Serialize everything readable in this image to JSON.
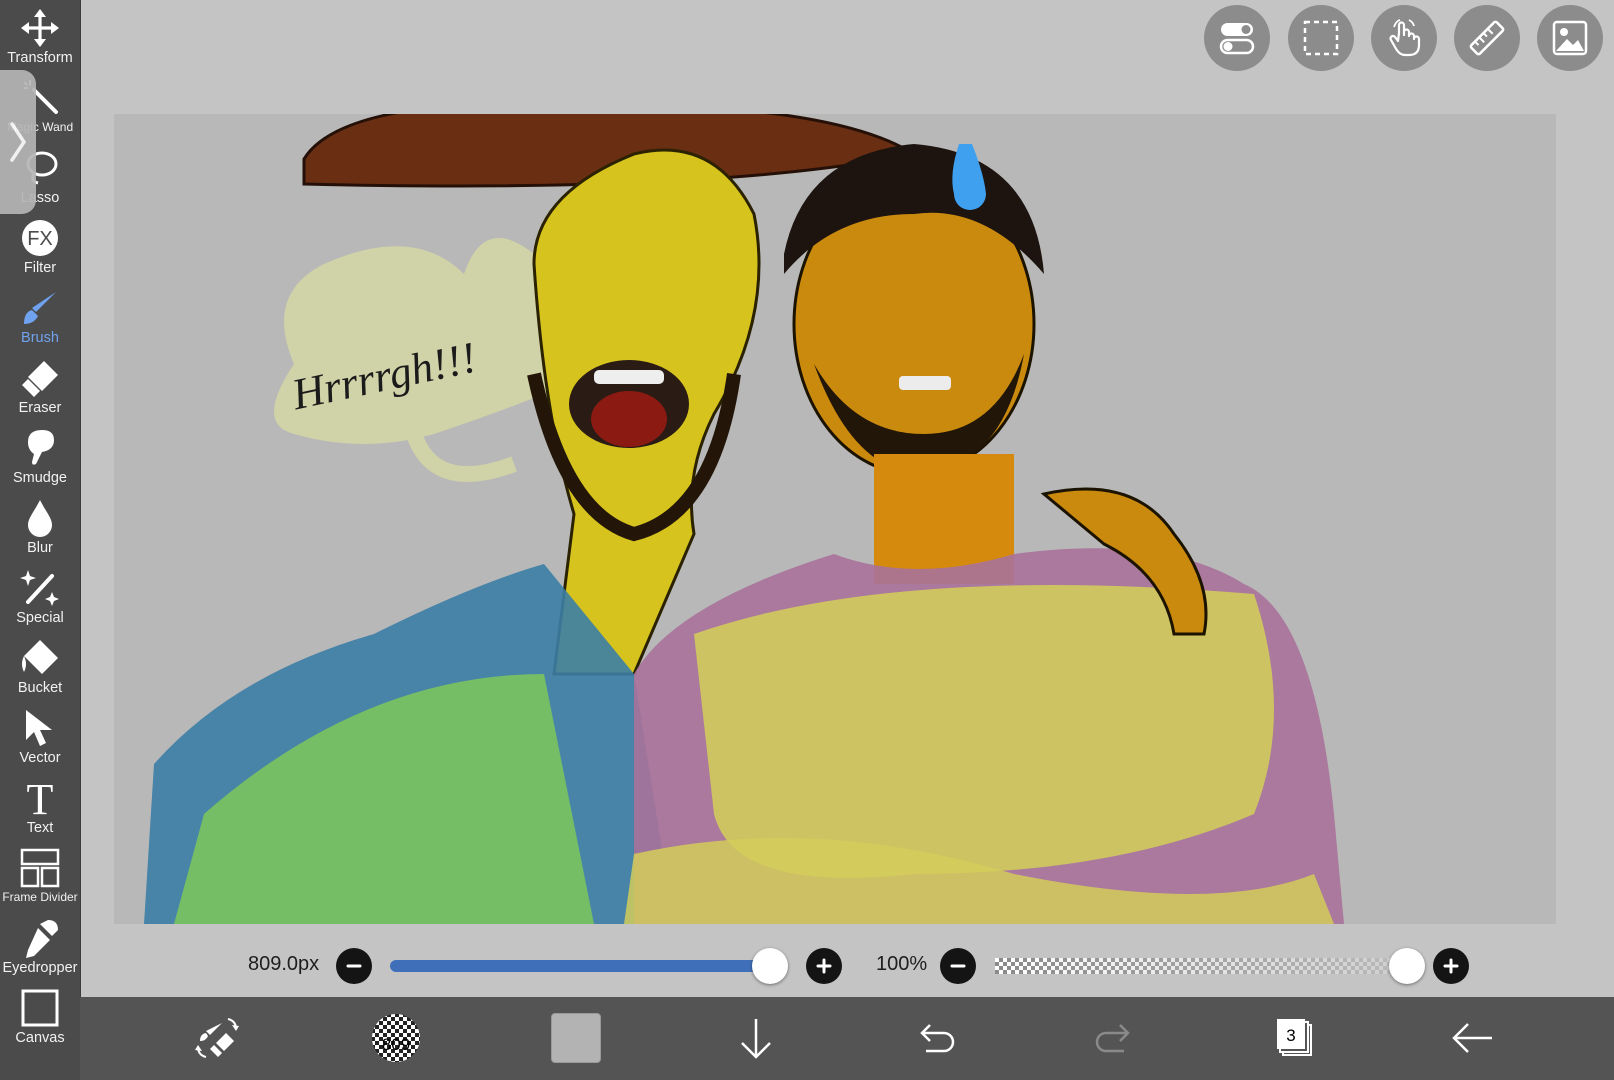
{
  "toolbar": {
    "tools": [
      {
        "id": "transform",
        "label": "Transform"
      },
      {
        "id": "magic-wand",
        "label": "Magic Wand"
      },
      {
        "id": "lasso",
        "label": "Lasso"
      },
      {
        "id": "filter",
        "label": "Filter",
        "glyph": "FX"
      },
      {
        "id": "brush",
        "label": "Brush"
      },
      {
        "id": "eraser",
        "label": "Eraser"
      },
      {
        "id": "smudge",
        "label": "Smudge"
      },
      {
        "id": "blur",
        "label": "Blur"
      },
      {
        "id": "special",
        "label": "Special"
      },
      {
        "id": "bucket",
        "label": "Bucket"
      },
      {
        "id": "vector",
        "label": "Vector"
      },
      {
        "id": "text",
        "label": "Text",
        "glyph": "T"
      },
      {
        "id": "frame-divider",
        "label": "Frame Divider"
      },
      {
        "id": "eyedropper",
        "label": "Eyedropper"
      },
      {
        "id": "canvas",
        "label": "Canvas"
      }
    ],
    "active_tool": "brush",
    "active_color": "#6fa3ef"
  },
  "top_buttons": [
    "toggle-icon",
    "selection-icon",
    "gesture-hand-icon",
    "ruler-icon",
    "image-icon"
  ],
  "canvas": {
    "speech_bubble_text": "Hrrrrgh!!!"
  },
  "brush_size": {
    "value_label": "809.0px",
    "fraction": 0.97
  },
  "opacity": {
    "value_label": "100%",
    "fraction": 1.0
  },
  "bottom_bar": {
    "brush_size_badge": "809",
    "layer_count": "3",
    "current_color": "#b3b3b3"
  }
}
